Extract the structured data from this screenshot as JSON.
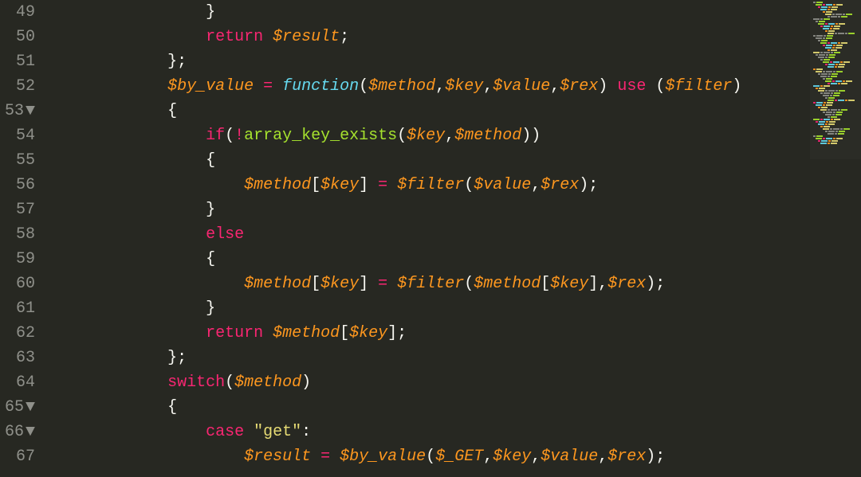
{
  "lines": [
    {
      "num": "49",
      "fold": "",
      "indent": "                ",
      "tokens": [
        [
          "}",
          "c-punc"
        ]
      ]
    },
    {
      "num": "50",
      "fold": "",
      "indent": "                ",
      "tokens": [
        [
          "return",
          "c-keyword"
        ],
        [
          " ",
          "c-text"
        ],
        [
          "$result",
          "c-var"
        ],
        [
          ";",
          "c-punc"
        ]
      ]
    },
    {
      "num": "51",
      "fold": "",
      "indent": "            ",
      "tokens": [
        [
          "};",
          "c-punc"
        ]
      ]
    },
    {
      "num": "52",
      "fold": "",
      "indent": "            ",
      "tokens": [
        [
          "$by_value",
          "c-var"
        ],
        [
          " ",
          "c-text"
        ],
        [
          "=",
          "c-keyword"
        ],
        [
          " ",
          "c-text"
        ],
        [
          "function",
          "c-storage"
        ],
        [
          "(",
          "c-punc"
        ],
        [
          "$method",
          "c-var"
        ],
        [
          ",",
          "c-punc"
        ],
        [
          "$key",
          "c-var"
        ],
        [
          ",",
          "c-punc"
        ],
        [
          "$value",
          "c-var"
        ],
        [
          ",",
          "c-punc"
        ],
        [
          "$rex",
          "c-var"
        ],
        [
          ")",
          "c-punc"
        ],
        [
          " ",
          "c-text"
        ],
        [
          "use",
          "c-keyword"
        ],
        [
          " ",
          "c-text"
        ],
        [
          "(",
          "c-punc"
        ],
        [
          "$filter",
          "c-var"
        ],
        [
          ")",
          "c-punc"
        ]
      ]
    },
    {
      "num": "53",
      "fold": "▼",
      "indent": "            ",
      "tokens": [
        [
          "{",
          "c-punc"
        ]
      ]
    },
    {
      "num": "54",
      "fold": "",
      "indent": "                ",
      "tokens": [
        [
          "if",
          "c-keyword"
        ],
        [
          "(",
          "c-punc"
        ],
        [
          "!",
          "c-keyword"
        ],
        [
          "array_key_exists",
          "c-func"
        ],
        [
          "(",
          "c-punc"
        ],
        [
          "$key",
          "c-var"
        ],
        [
          ",",
          "c-punc"
        ],
        [
          "$method",
          "c-var"
        ],
        [
          "))",
          "c-punc"
        ]
      ]
    },
    {
      "num": "55",
      "fold": "",
      "indent": "                ",
      "tokens": [
        [
          "{",
          "c-punc"
        ]
      ]
    },
    {
      "num": "56",
      "fold": "",
      "indent": "                    ",
      "tokens": [
        [
          "$method",
          "c-var"
        ],
        [
          "[",
          "c-punc"
        ],
        [
          "$key",
          "c-var"
        ],
        [
          "]",
          "c-punc"
        ],
        [
          " ",
          "c-text"
        ],
        [
          "=",
          "c-keyword"
        ],
        [
          " ",
          "c-text"
        ],
        [
          "$filter",
          "c-var"
        ],
        [
          "(",
          "c-punc"
        ],
        [
          "$value",
          "c-var"
        ],
        [
          ",",
          "c-punc"
        ],
        [
          "$rex",
          "c-var"
        ],
        [
          ");",
          "c-punc"
        ]
      ]
    },
    {
      "num": "57",
      "fold": "",
      "indent": "                ",
      "tokens": [
        [
          "}",
          "c-punc"
        ]
      ]
    },
    {
      "num": "58",
      "fold": "",
      "indent": "                ",
      "tokens": [
        [
          "else",
          "c-keyword"
        ]
      ]
    },
    {
      "num": "59",
      "fold": "",
      "indent": "                ",
      "tokens": [
        [
          "{",
          "c-punc"
        ]
      ]
    },
    {
      "num": "60",
      "fold": "",
      "indent": "                    ",
      "tokens": [
        [
          "$method",
          "c-var"
        ],
        [
          "[",
          "c-punc"
        ],
        [
          "$key",
          "c-var"
        ],
        [
          "]",
          "c-punc"
        ],
        [
          " ",
          "c-text"
        ],
        [
          "=",
          "c-keyword"
        ],
        [
          " ",
          "c-text"
        ],
        [
          "$filter",
          "c-var"
        ],
        [
          "(",
          "c-punc"
        ],
        [
          "$method",
          "c-var"
        ],
        [
          "[",
          "c-punc"
        ],
        [
          "$key",
          "c-var"
        ],
        [
          "],",
          "c-punc"
        ],
        [
          "$rex",
          "c-var"
        ],
        [
          ");",
          "c-punc"
        ]
      ]
    },
    {
      "num": "61",
      "fold": "",
      "indent": "                ",
      "tokens": [
        [
          "}",
          "c-punc"
        ]
      ]
    },
    {
      "num": "62",
      "fold": "",
      "indent": "                ",
      "tokens": [
        [
          "return",
          "c-keyword"
        ],
        [
          " ",
          "c-text"
        ],
        [
          "$method",
          "c-var"
        ],
        [
          "[",
          "c-punc"
        ],
        [
          "$key",
          "c-var"
        ],
        [
          "];",
          "c-punc"
        ]
      ]
    },
    {
      "num": "63",
      "fold": "",
      "indent": "            ",
      "tokens": [
        [
          "};",
          "c-punc"
        ]
      ]
    },
    {
      "num": "64",
      "fold": "",
      "indent": "            ",
      "tokens": [
        [
          "switch",
          "c-keyword"
        ],
        [
          "(",
          "c-punc"
        ],
        [
          "$method",
          "c-var"
        ],
        [
          ")",
          "c-punc"
        ]
      ]
    },
    {
      "num": "65",
      "fold": "▼",
      "indent": "            ",
      "tokens": [
        [
          "{",
          "c-punc"
        ]
      ]
    },
    {
      "num": "66",
      "fold": "▼",
      "indent": "                ",
      "tokens": [
        [
          "case",
          "c-keyword"
        ],
        [
          " ",
          "c-text"
        ],
        [
          "\"get\"",
          "c-string"
        ],
        [
          ":",
          "c-punc"
        ]
      ]
    },
    {
      "num": "67",
      "fold": "",
      "indent": "                    ",
      "tokens": [
        [
          "$result",
          "c-var"
        ],
        [
          " ",
          "c-text"
        ],
        [
          "=",
          "c-keyword"
        ],
        [
          " ",
          "c-text"
        ],
        [
          "$by_value",
          "c-var"
        ],
        [
          "(",
          "c-punc"
        ],
        [
          "$_GET",
          "c-var"
        ],
        [
          ",",
          "c-punc"
        ],
        [
          "$key",
          "c-var"
        ],
        [
          ",",
          "c-punc"
        ],
        [
          "$value",
          "c-var"
        ],
        [
          ",",
          "c-punc"
        ],
        [
          "$rex",
          "c-var"
        ],
        [
          ");",
          "c-punc"
        ]
      ]
    }
  ]
}
